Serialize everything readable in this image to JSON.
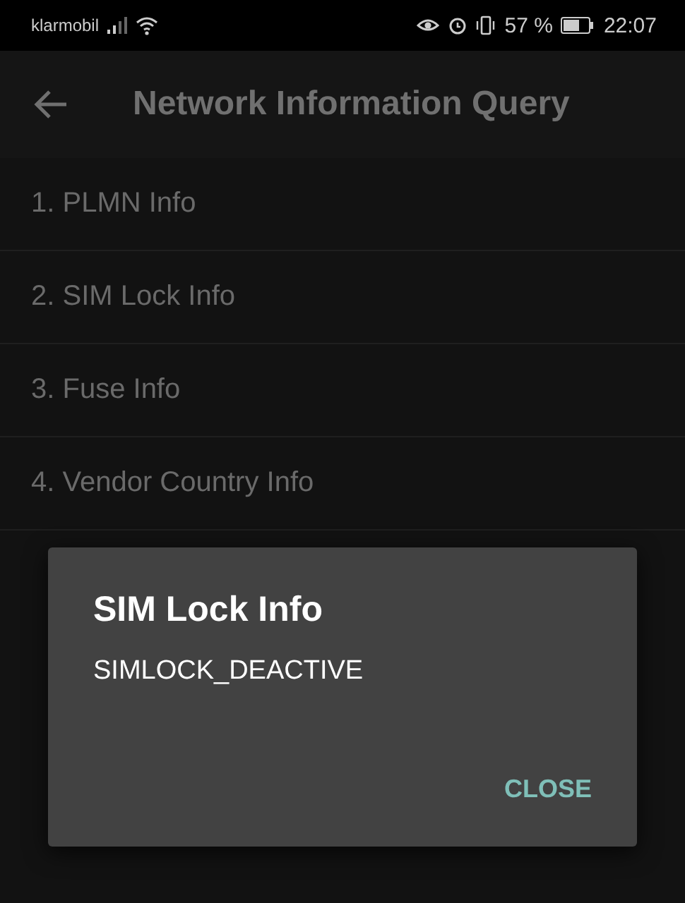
{
  "status_bar": {
    "carrier": "klarmobil",
    "battery_percent": "57 %",
    "time": "22:07"
  },
  "app_bar": {
    "title": "Network Information Query"
  },
  "items": [
    {
      "label": "1. PLMN Info"
    },
    {
      "label": "2. SIM Lock Info"
    },
    {
      "label": "3. Fuse Info"
    },
    {
      "label": "4. Vendor Country Info"
    }
  ],
  "dialog": {
    "title": "SIM Lock Info",
    "message": "SIMLOCK_DEACTIVE",
    "buttons": [
      "CLOSE"
    ]
  }
}
